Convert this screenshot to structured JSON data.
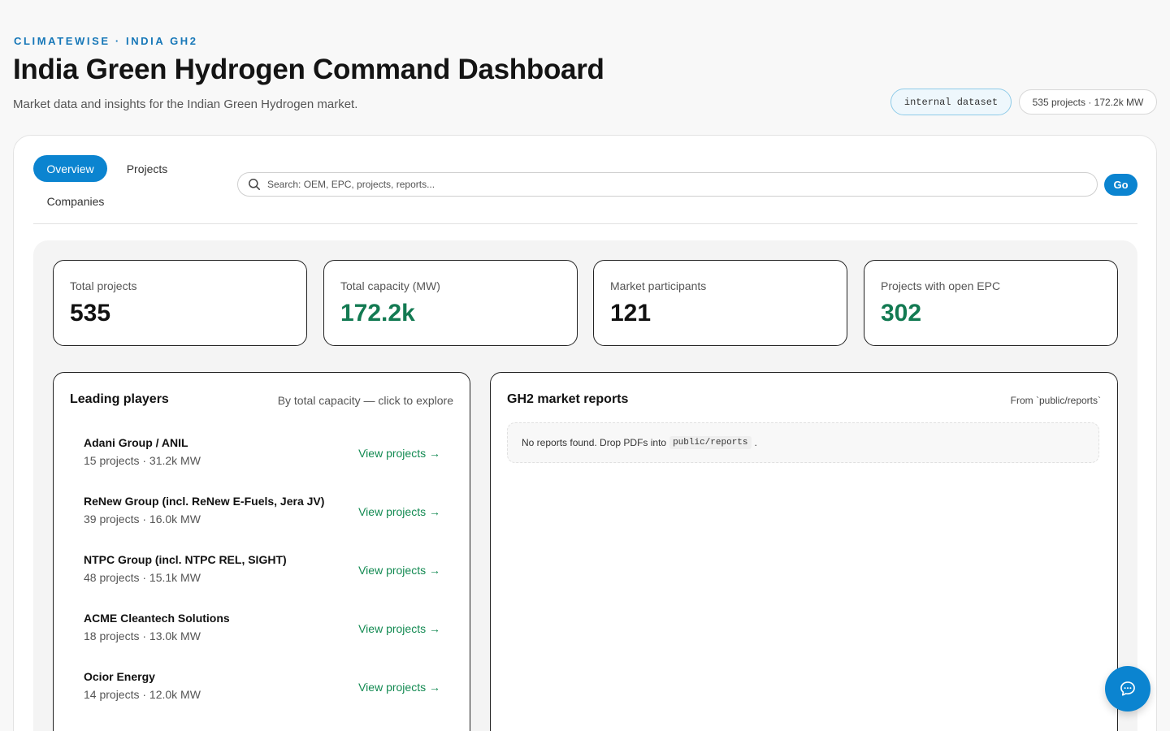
{
  "header": {
    "eyebrow": "CLIMATEWISE · INDIA GH2",
    "title": "India Green Hydrogen Command Dashboard",
    "subtitle": "Market data and insights for the Indian Green Hydrogen market.",
    "dataset_badge": "internal dataset",
    "stats_badge": "535 projects · 172.2k MW"
  },
  "nav": {
    "tabs": [
      {
        "label": "Overview",
        "active": true
      },
      {
        "label": "Projects",
        "active": false
      },
      {
        "label": "Companies",
        "active": false
      }
    ]
  },
  "search": {
    "placeholder": "Search: OEM, EPC, projects, reports...",
    "value": "",
    "button_label": "Go"
  },
  "kpis": [
    {
      "label": "Total projects",
      "value": "535",
      "accent": false
    },
    {
      "label": "Total capacity (MW)",
      "value": "172.2k",
      "accent": true
    },
    {
      "label": "Market participants",
      "value": "121",
      "accent": false
    },
    {
      "label": "Projects with open EPC",
      "value": "302",
      "accent": true
    }
  ],
  "leading_players": {
    "title": "Leading players",
    "hint": "By total capacity — click to explore",
    "items": [
      {
        "name": "Adani Group / ANIL",
        "meta": "15 projects · 31.2k MW",
        "link": "View projects →"
      },
      {
        "name": "ReNew Group (incl. ReNew E-Fuels, Jera JV)",
        "meta": "39 projects · 16.0k MW",
        "link": "View projects →"
      },
      {
        "name": "NTPC Group (incl. NTPC REL, SIGHT)",
        "meta": "48 projects · 15.1k MW",
        "link": "View projects →"
      },
      {
        "name": "ACME Cleantech Solutions",
        "meta": "18 projects · 13.0k MW",
        "link": "View projects →"
      },
      {
        "name": "Ocior Energy",
        "meta": "14 projects · 12.0k MW",
        "link": "View projects →"
      }
    ]
  },
  "reports": {
    "title": "GH2 market reports",
    "hint": "From `public/reports`",
    "empty_prefix": "No reports found. Drop PDFs into",
    "empty_code": "public/reports",
    "empty_suffix": "."
  },
  "colors": {
    "accent_blue": "#0b84d0",
    "accent_green": "#137a52",
    "eyebrow_blue": "#1677b8"
  },
  "icons": {
    "search": "search-icon",
    "chat": "chat-icon"
  }
}
